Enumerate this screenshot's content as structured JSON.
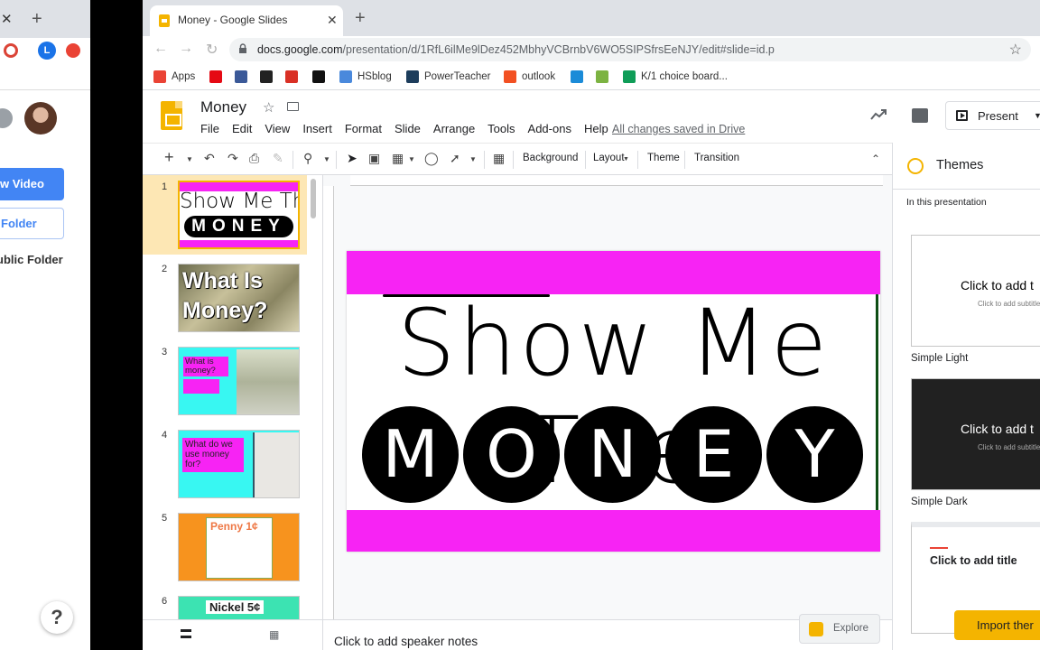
{
  "left_window": {
    "tab_close": "✕",
    "new_tab": "+",
    "profile_initial": "L",
    "buttons": [
      "w Video",
      "Folder"
    ],
    "text": "ublic Folder",
    "help": "?"
  },
  "browser": {
    "tab_title": "Money - Google Slides",
    "tab_close": "✕",
    "new_tab": "+",
    "url_host": "docs.google.com",
    "url_path": "/presentation/d/1RfL6ilMe9lDez452MbhyVCBrnbV6WO5SIPSfrsEeNJY/edit#slide=id.p",
    "bookmarks": [
      {
        "label": "Apps",
        "color": "#ea4335"
      },
      {
        "label": "",
        "color": "#e50914"
      },
      {
        "label": "",
        "color": "#3b5998"
      },
      {
        "label": "",
        "color": "#222222"
      },
      {
        "label": "",
        "color": "#d93025"
      },
      {
        "label": "",
        "color": "#111111"
      },
      {
        "label": "HSblog",
        "color": "#4a89dc"
      },
      {
        "label": "PowerTeacher",
        "color": "#1d3d5c"
      },
      {
        "label": "outlook",
        "color": "#f25022"
      },
      {
        "label": "",
        "color": "#1b8bd8"
      },
      {
        "label": "",
        "color": "#7cb342"
      },
      {
        "label": "K/1 choice board...",
        "color": "#0f9d58"
      }
    ]
  },
  "slides_app": {
    "doc_title": "Money",
    "menus": [
      "File",
      "Edit",
      "View",
      "Insert",
      "Format",
      "Slide",
      "Arrange",
      "Tools",
      "Add-ons",
      "Help"
    ],
    "save_status": "All changes saved in Drive",
    "present_label": "Present",
    "toolbar": {
      "background": "Background",
      "layout": "Layout",
      "theme": "Theme",
      "transition": "Transition"
    },
    "slides": [
      {
        "num": "1",
        "title": "Show Me The",
        "sub": "MONEY"
      },
      {
        "num": "2",
        "title": "What Is Money?"
      },
      {
        "num": "3",
        "title": "What is money?"
      },
      {
        "num": "4",
        "title": "What do we use money for?"
      },
      {
        "num": "5",
        "title": "Penny 1¢"
      },
      {
        "num": "6",
        "title": "Nickel 5¢"
      }
    ],
    "current_slide": {
      "title": "Show Me The",
      "letters": [
        "M",
        "O",
        "N",
        "E",
        "Y"
      ]
    },
    "speaker_notes_placeholder": "Click to add speaker notes",
    "explore_label": "Explore"
  },
  "themes_panel": {
    "title": "Themes",
    "section": "In this presentation",
    "themes": [
      {
        "name": "Simple Light",
        "title": "Click to add t",
        "subtitle": "Click to add subtitle"
      },
      {
        "name": "Simple Dark",
        "title": "Click to add t",
        "subtitle": "Click to add subtitle"
      },
      {
        "name": "",
        "title": "Click to add title",
        "subtitle": ""
      }
    ],
    "import_label": "Import ther"
  },
  "colors": {
    "magenta": "#f723f4",
    "slides_yellow": "#f4b400",
    "cyan": "#38f7f2",
    "orange": "#f7931e"
  }
}
